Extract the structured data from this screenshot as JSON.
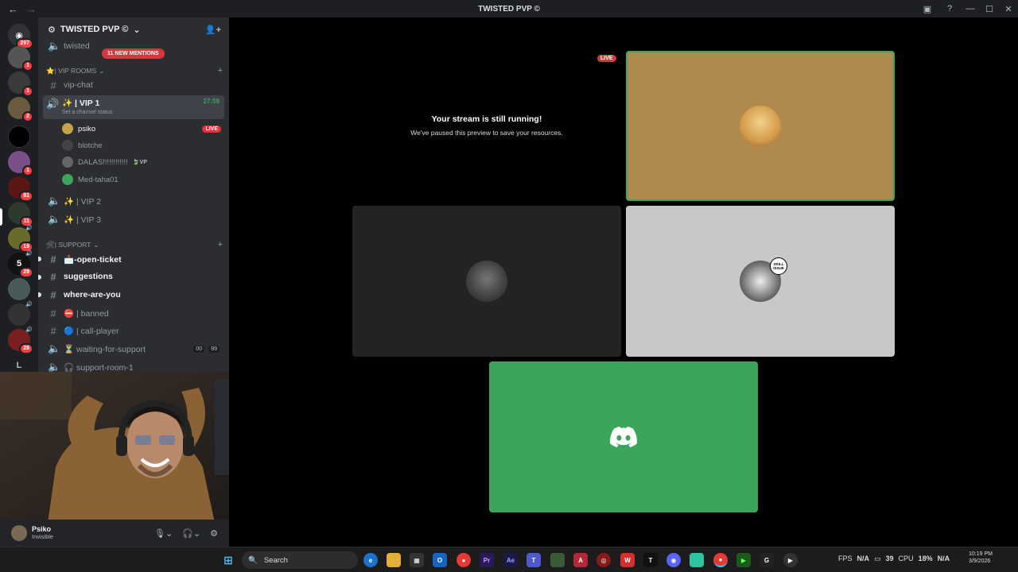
{
  "titlebar": {
    "back": "←",
    "forward": "→",
    "title": "TWISTED PVP ©"
  },
  "rail": {
    "dm_badge": "297",
    "servers": [
      {
        "badge": "1"
      },
      {
        "badge": "1"
      },
      {
        "badge": "2"
      },
      {
        "badge": ""
      },
      {
        "badge": "1"
      },
      {
        "badge": "81"
      },
      {
        "badge": "11"
      },
      {
        "badge": "19"
      },
      {
        "badge": "29"
      },
      {
        "badge": ""
      },
      {
        "badge": ""
      },
      {
        "badge": "28"
      }
    ],
    "letter_server": "L",
    "five_s_label": "5"
  },
  "sidebar": {
    "guild_name": "TWISTED PVP ©",
    "top_channel": "twisted",
    "mentions_pill": "11 NEW MENTIONS",
    "vip_category": "⭐| VIP ROOMS",
    "vip_chat": "vip-chat",
    "vip1": {
      "name": "✨ | VIP 1",
      "status_hint": "Set a channel status",
      "timer": "27:59"
    },
    "members": [
      {
        "name": "psiko",
        "tag": "LIVE"
      },
      {
        "name": "blotche",
        "tag": ""
      },
      {
        "name": "DALAS!!!!!!!!!!!!",
        "tag": "VP"
      },
      {
        "name": "Med-taha01",
        "tag": ""
      }
    ],
    "vip2": "✨ | VIP 2",
    "vip3": "✨ | VIP 3",
    "support_category": "🛠| SUPPORT",
    "support_channels": [
      {
        "name": "📩-open-ticket",
        "bright": true
      },
      {
        "name": "suggestions",
        "bright": true
      },
      {
        "name": "where-are-you",
        "bright": true
      },
      {
        "name": "⛔ | banned",
        "bright": false
      },
      {
        "name": "🔵 | call-player",
        "bright": false
      }
    ],
    "waiting": {
      "name": "⏳ waiting-for-support",
      "c1": "00",
      "c2": "99"
    },
    "support_room": "🎧 support-room-1"
  },
  "user": {
    "name": "Psiko",
    "status": "Invisible"
  },
  "stage": {
    "paused_title": "Your stream is still running!",
    "paused_sub": "We've paused this preview to save your resources.",
    "live_tag": "LIVE",
    "sticker": "SKILL ISSUE"
  },
  "taskbar": {
    "search": "Search",
    "apps": [
      "Pr",
      "Ae",
      "T",
      "W"
    ],
    "fps_label": "FPS",
    "fps_val": "N/A",
    "gpu": "39",
    "cpu_label": "CPU",
    "cpu_val": "18%",
    "lat_val": "N/A",
    "time": "10:19 PM",
    "date": "3/9/2026"
  },
  "colors": {
    "accent_live": "#da373c",
    "discord_green": "#3ba55c",
    "tile_gold": "#b08a4c",
    "tile_gray": "#c8c8c8"
  }
}
